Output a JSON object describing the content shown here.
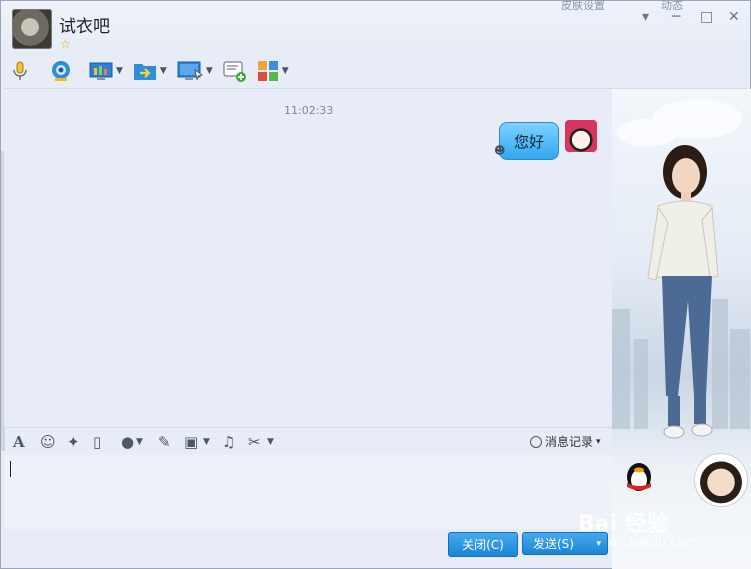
{
  "window": {
    "contact_name": "试衣吧",
    "star": "☆",
    "top_hint_1": "皮肤设置",
    "top_hint_2": "动态",
    "controls": {
      "menu": "▾",
      "minimize": "─",
      "maximize": "□",
      "close": "✕"
    }
  },
  "toolbar": {
    "items": [
      {
        "name": "voice-call-icon"
      },
      {
        "name": "video-call-icon"
      },
      {
        "name": "screen-share-icon"
      },
      {
        "name": "send-file-icon"
      },
      {
        "name": "remote-desktop-icon"
      },
      {
        "name": "create-group-icon"
      },
      {
        "name": "apps-icon"
      }
    ]
  },
  "chat": {
    "timestamp": "11:02:33",
    "messages": [
      {
        "text": "您好",
        "from": "self"
      }
    ]
  },
  "input_toolbar": {
    "font": "A",
    "emoji": "☺",
    "magic": "✦",
    "shake": "▯",
    "mic": "●",
    "edit": "✎",
    "image": "▣",
    "music": "♫",
    "scissors": "✂",
    "history_label": "消息记录",
    "history_caret": "▾"
  },
  "buttons": {
    "close_label": "关闭(C)",
    "send_label": "发送(S)",
    "send_caret": "▾"
  },
  "watermark": {
    "text": "Bai 经验",
    "url": "jingyan.baidu.com"
  },
  "colors": {
    "accent": "#1b86d6",
    "bubble": "#48b5f3"
  }
}
